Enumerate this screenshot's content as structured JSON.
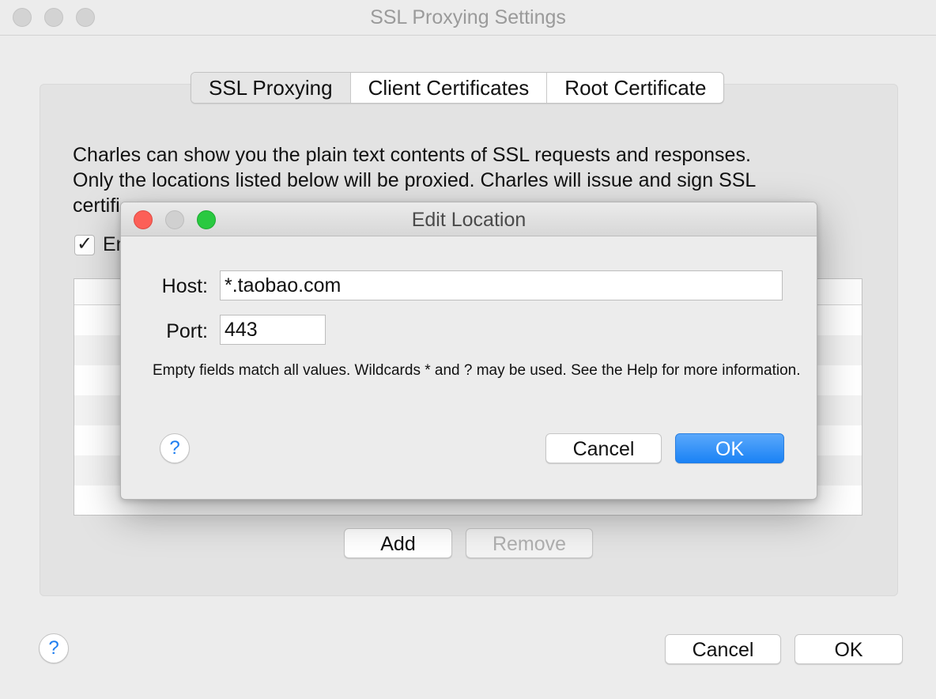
{
  "window": {
    "title": "SSL Proxying Settings"
  },
  "tabs": [
    {
      "label": "SSL Proxying",
      "active": true
    },
    {
      "label": "Client Certificates",
      "active": false
    },
    {
      "label": "Root Certificate",
      "active": false
    }
  ],
  "description": {
    "line1": "Charles can show you the plain text contents of SSL requests and responses.",
    "line2": "Only the locations listed below will be proxied. Charles will issue and sign SSL",
    "line3_visible": "certifi"
  },
  "enable_checkbox": {
    "checked": true,
    "label_visible": "En"
  },
  "list_buttons": {
    "add": "Add",
    "remove": "Remove"
  },
  "footer": {
    "help": "?",
    "cancel": "Cancel",
    "ok": "OK"
  },
  "dialog": {
    "title": "Edit Location",
    "host_label": "Host:",
    "host_value": "*.taobao.com",
    "port_label": "Port:",
    "port_value": "443",
    "note": "Empty fields match all values. Wildcards * and ? may be used. See the Help for more information.",
    "help": "?",
    "cancel": "Cancel",
    "ok": "OK"
  },
  "colors": {
    "accent": "#1a82f5",
    "close": "#fc5f57",
    "minimize_inactive": "#d0d0d0",
    "zoom": "#29c940"
  }
}
